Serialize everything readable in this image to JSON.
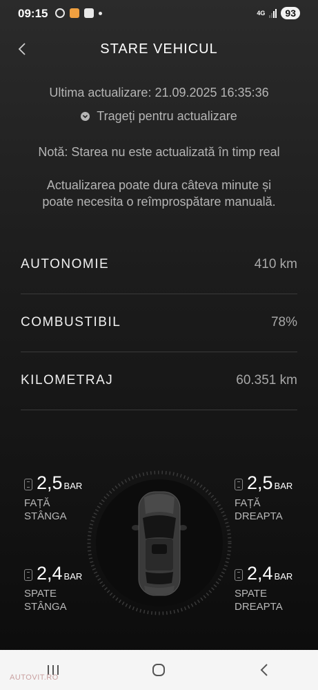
{
  "status_bar": {
    "time": "09:15",
    "network": "4G",
    "battery": "93"
  },
  "header": {
    "title": "STARE VEHICUL"
  },
  "update": {
    "last_update": "Ultima actualizare: 21.09.2025 16:35:36",
    "pull_to_refresh": "Trageți pentru actualizare",
    "note": "Notă: Starea nu este actualizată în timp real",
    "info_line1": "Actualizarea poate dura câteva minute și",
    "info_line2": "poate necesita o reîmprospătare manuală."
  },
  "stats": [
    {
      "label": "AUTONOMIE",
      "value": "410 km"
    },
    {
      "label": "COMBUSTIBIL",
      "value": "78%"
    },
    {
      "label": "KILOMETRAJ",
      "value": "60.351 km"
    }
  ],
  "tires": {
    "front_left": {
      "value": "2,5",
      "unit": "BAR",
      "line1": "FAȚĂ",
      "line2": "STÂNGA"
    },
    "front_right": {
      "value": "2,5",
      "unit": "BAR",
      "line1": "FAȚĂ",
      "line2": "DREAPTA"
    },
    "rear_left": {
      "value": "2,4",
      "unit": "BAR",
      "line1": "SPATE",
      "line2": "STÂNGA"
    },
    "rear_right": {
      "value": "2,4",
      "unit": "BAR",
      "line1": "SPATE",
      "line2": "DREAPTA"
    }
  },
  "watermark": "AUTOVIT.RO",
  "nav": {
    "icons": [
      "recent-apps-icon",
      "home-icon",
      "back-icon"
    ]
  }
}
